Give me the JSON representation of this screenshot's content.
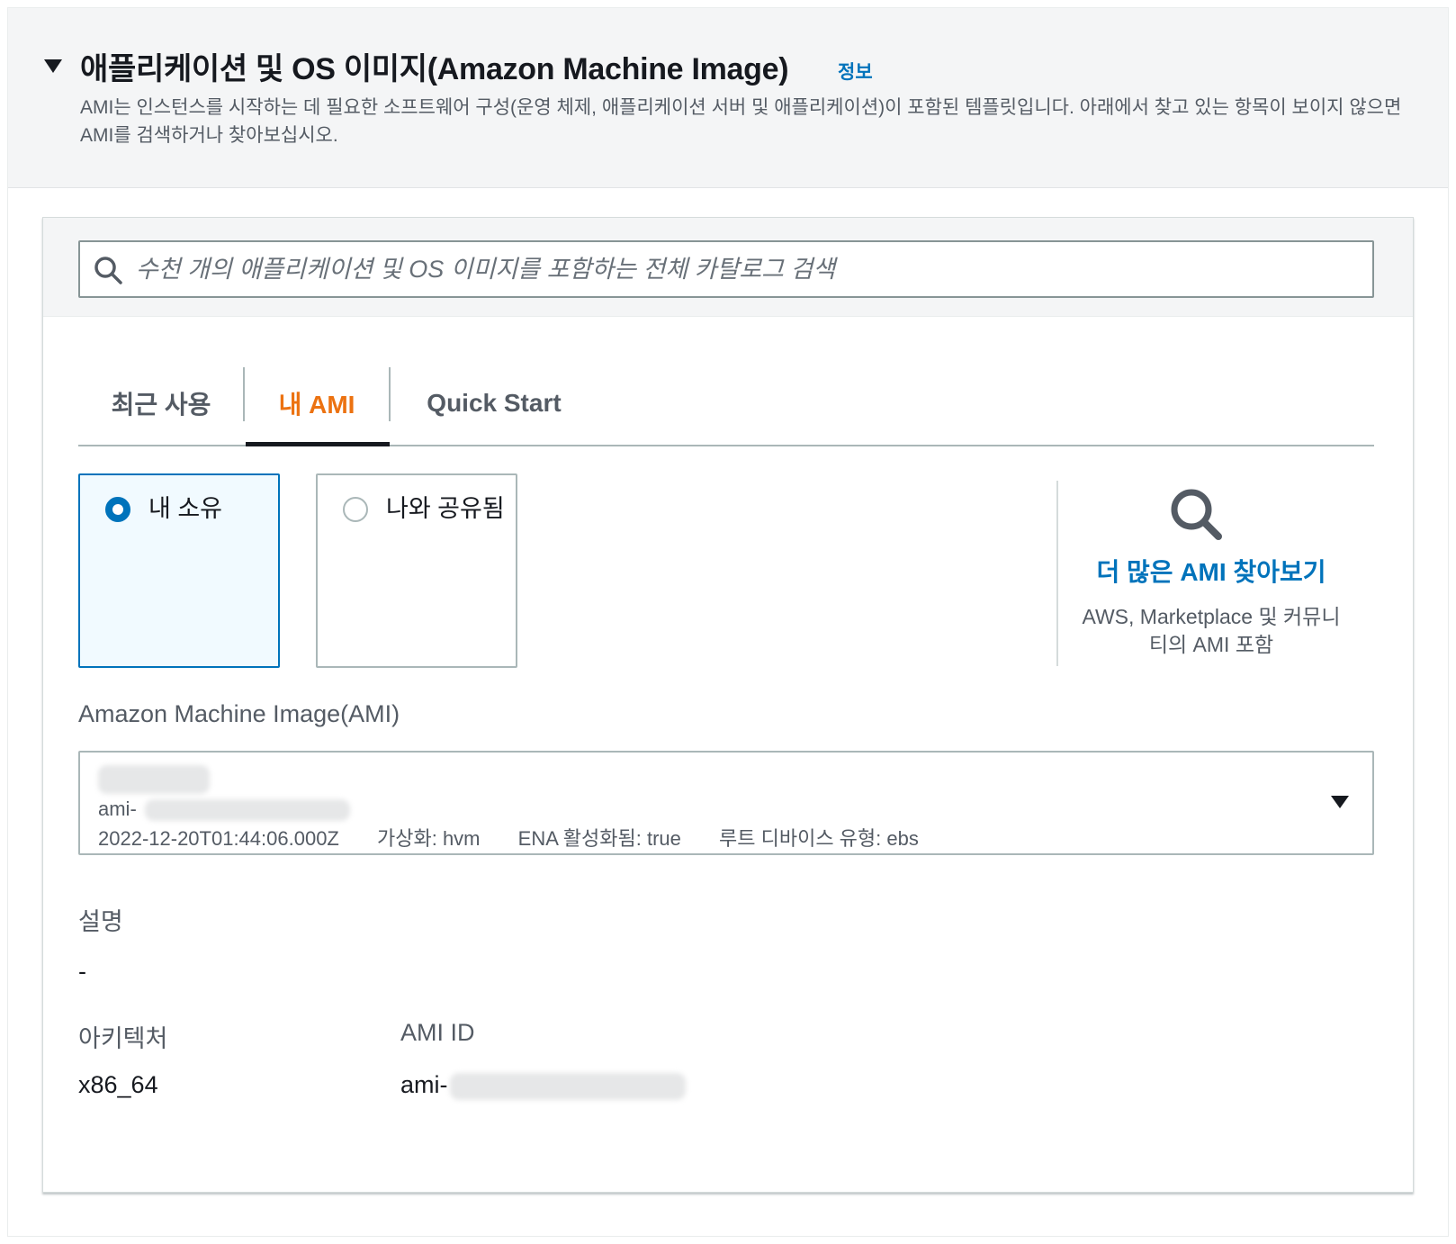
{
  "section": {
    "title": "애플리케이션 및 OS 이미지(Amazon Machine Image)",
    "info_link": "정보",
    "description": "AMI는 인스턴스를 시작하는 데 필요한 소프트웨어 구성(운영 체제, 애플리케이션 서버 및 애플리케이션)이 포함된 템플릿입니다. 아래에서 찾고 있는 항목이 보이지 않으면 AMI를 검색하거나 찾아보십시오."
  },
  "search": {
    "placeholder": "수천 개의 애플리케이션 및 OS 이미지를 포함하는 전체 카탈로그 검색",
    "value": ""
  },
  "tabs": [
    {
      "label": "최근 사용",
      "active": false
    },
    {
      "label": "내 AMI",
      "active": true
    },
    {
      "label": "Quick Start",
      "active": false
    }
  ],
  "ownership": {
    "options": [
      {
        "label": "내 소유",
        "selected": true
      },
      {
        "label": "나와 공유됨",
        "selected": false
      }
    ]
  },
  "browse_more": {
    "link": "더 많은 AMI 찾아보기",
    "description": "AWS, Marketplace 및 커뮤니티의 AMI 포함"
  },
  "ami_select": {
    "label": "Amazon Machine Image(AMI)",
    "ami_prefix": "ami-",
    "created": "2022-12-20T01:44:06.000Z",
    "virtualization": "가상화: hvm",
    "ena": "ENA 활성화됨: true",
    "root_device": "루트 디바이스 유형: ebs"
  },
  "details": {
    "description_label": "설명",
    "description_value": "-",
    "architecture_label": "아키텍처",
    "architecture_value": "x86_64",
    "ami_id_label": "AMI ID",
    "ami_id_prefix": "ami-"
  },
  "colors": {
    "accent_orange": "#ec7211",
    "link_blue": "#0073bb",
    "selected_bg": "#f1faff",
    "header_bg": "#f4f5f6"
  },
  "icons": {
    "collapse": "caret-down-icon",
    "search": "search-icon",
    "browse": "magnifier-icon",
    "select": "caret-down-icon"
  }
}
